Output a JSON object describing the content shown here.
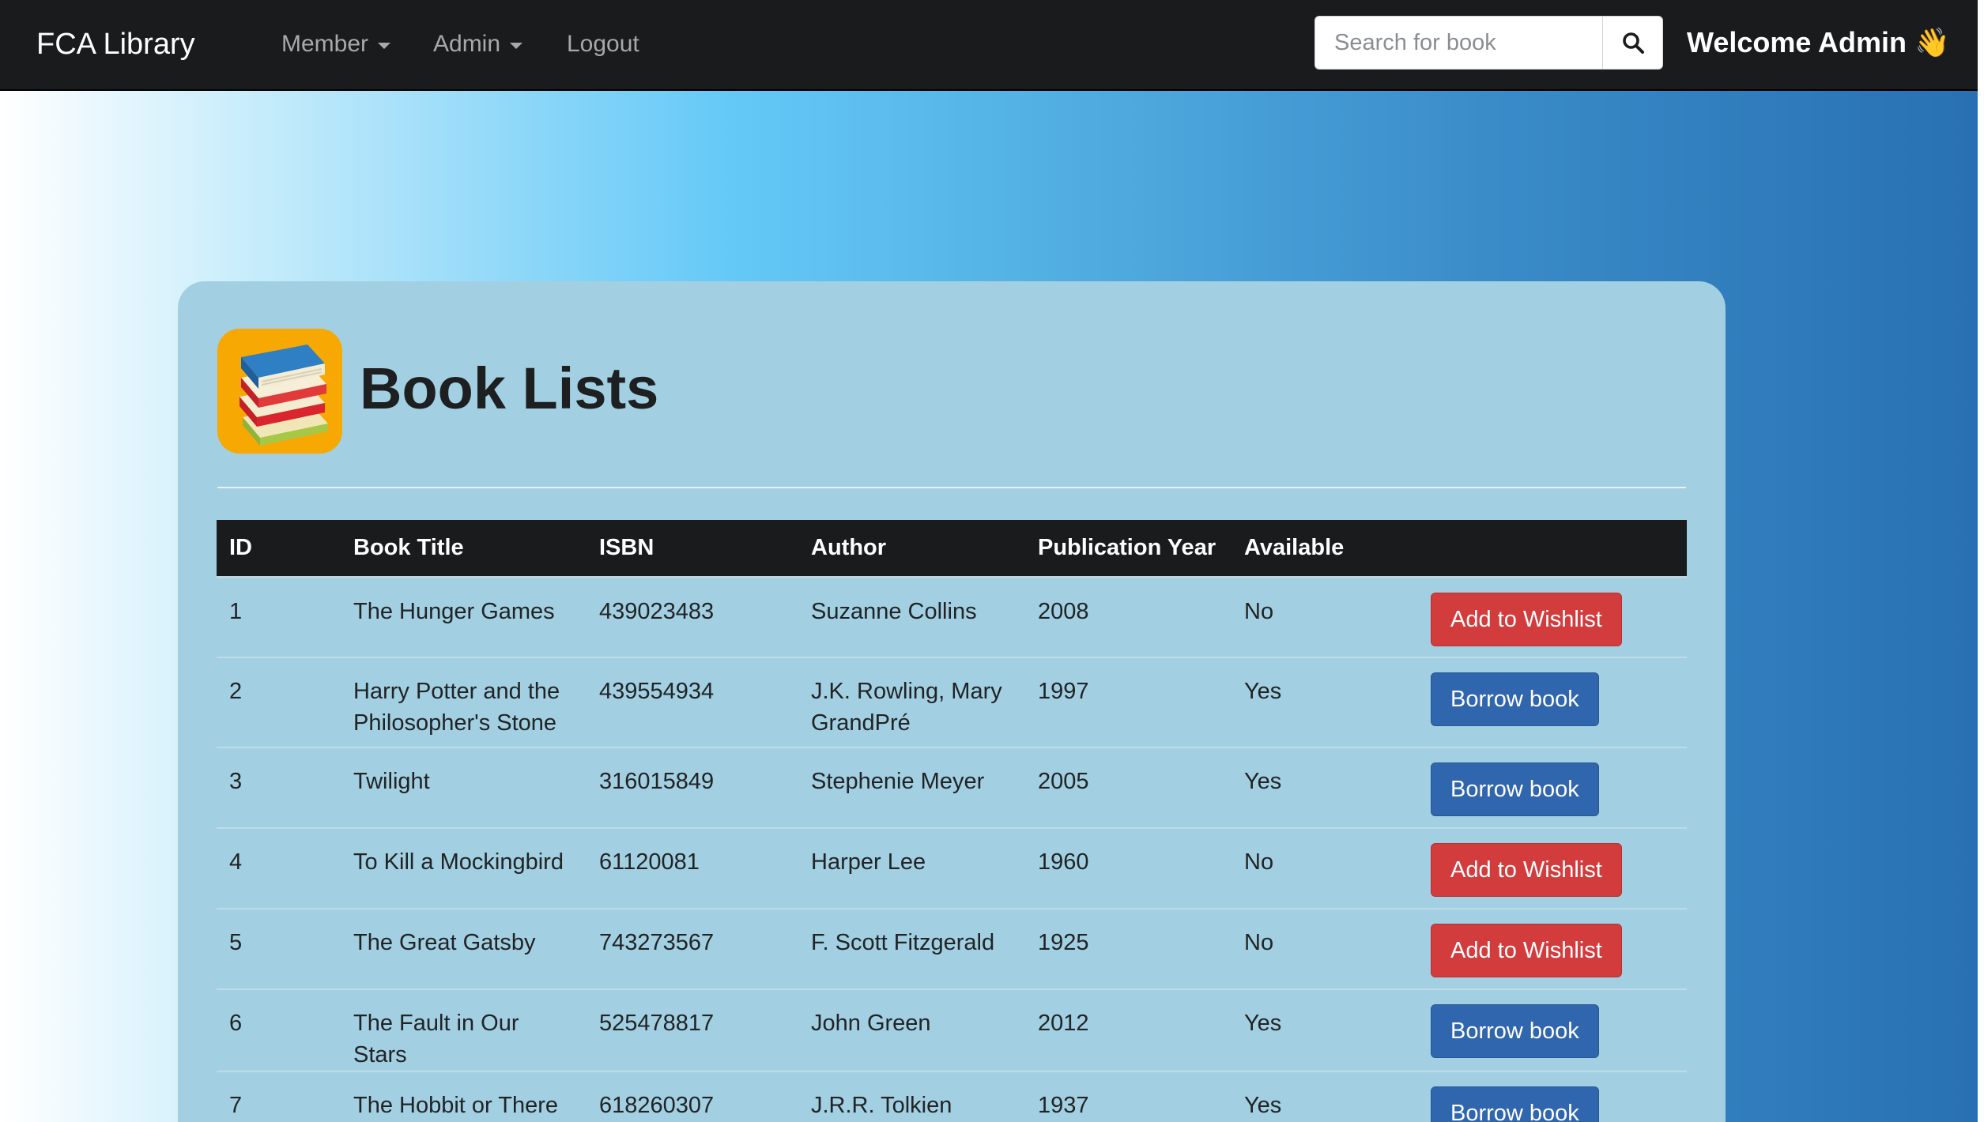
{
  "navbar": {
    "brand": "FCA Library",
    "menu": [
      {
        "label": "Member",
        "dropdown": true
      },
      {
        "label": "Admin",
        "dropdown": true
      },
      {
        "label": "Logout",
        "dropdown": false
      }
    ],
    "search": {
      "placeholder": "Search for book",
      "value": "",
      "icon": "search-icon"
    },
    "welcome": "Welcome Admin 👋"
  },
  "main": {
    "logo_icon": "books-icon",
    "title": "Book Lists",
    "table": {
      "headers": [
        "ID",
        "Book Title",
        "ISBN",
        "Author",
        "Publication Year",
        "Available",
        ""
      ],
      "rows": [
        {
          "id": "1",
          "title": "The Hunger Games",
          "isbn": "439023483",
          "author": "Suzanne Collins",
          "year": "2008",
          "available": "No",
          "action": "Add to Wishlist"
        },
        {
          "id": "2",
          "title": "Harry Potter and the Philosopher's Stone",
          "isbn": "439554934",
          "author": "J.K. Rowling, Mary GrandPré",
          "year": "1997",
          "available": "Yes",
          "action": "Borrow book"
        },
        {
          "id": "3",
          "title": "Twilight",
          "isbn": "316015849",
          "author": "Stephenie Meyer",
          "year": "2005",
          "available": "Yes",
          "action": "Borrow book"
        },
        {
          "id": "4",
          "title": "To Kill a Mockingbird",
          "isbn": "61120081",
          "author": "Harper Lee",
          "year": "1960",
          "available": "No",
          "action": "Add to Wishlist"
        },
        {
          "id": "5",
          "title": "The Great Gatsby",
          "isbn": "743273567",
          "author": "F. Scott Fitzgerald",
          "year": "1925",
          "available": "No",
          "action": "Add to Wishlist"
        },
        {
          "id": "6",
          "title": "The Fault in Our Stars",
          "isbn": "525478817",
          "author": "John Green",
          "year": "2012",
          "available": "Yes",
          "action": "Borrow book"
        },
        {
          "id": "7",
          "title": "The Hobbit or There",
          "isbn": "618260307",
          "author": "J.R.R. Tolkien",
          "year": "1937",
          "available": "Yes",
          "action": "Borrow book"
        }
      ]
    }
  },
  "colors": {
    "navbar_bg": "#1a1b1d",
    "panel_bg": "#a2d0e2",
    "wishlist_btn": "#d23c3c",
    "borrow_btn": "#2f66ad",
    "logo_bg": "#f7a803"
  }
}
